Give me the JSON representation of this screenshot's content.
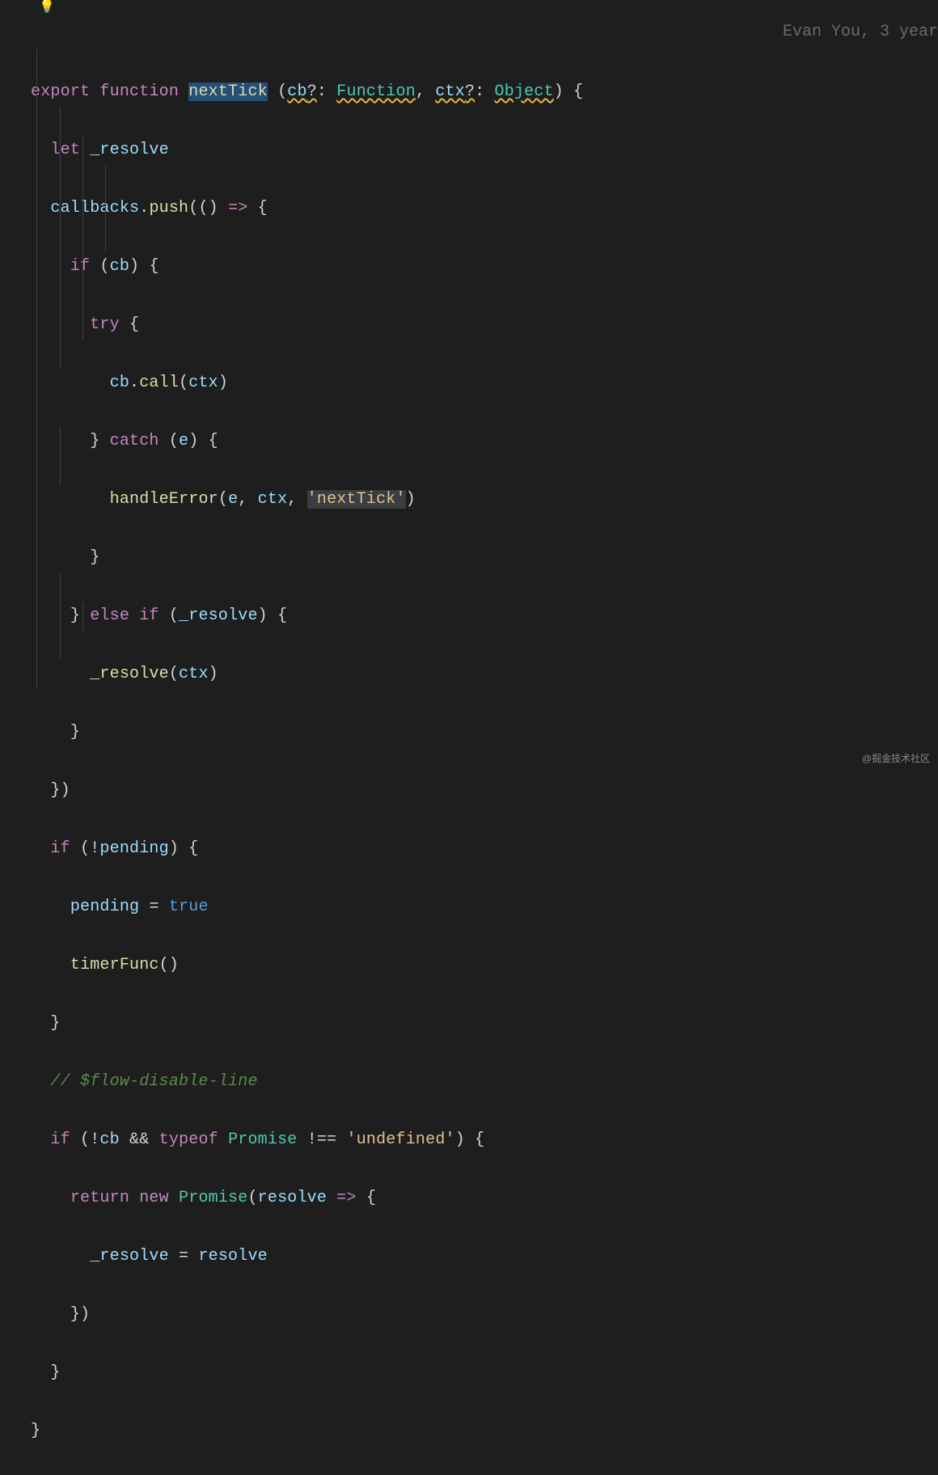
{
  "blame": "Evan You, 3 year",
  "bulb_icon": "💡",
  "watermark": "@掘金技术社区",
  "tokens": {
    "export": "export",
    "function": "function",
    "nextTick": "nextTick",
    "cb": "cb",
    "q": "?",
    "colon": ":",
    "Function": "Function",
    "comma": ",",
    "ctx": "ctx",
    "Object": "Object",
    "lbrace": "{",
    "rbrace": "}",
    "lparen": "(",
    "rparen": ")",
    "let": "let",
    "_resolve": "_resolve",
    "callbacks": "callbacks",
    "dot": ".",
    "push": "push",
    "arrow": "=>",
    "if": "if",
    "try": "try",
    "call": "call",
    "catch": "catch",
    "e": "e",
    "handleError": "handleError",
    "nextTickStr": "'nextTick'",
    "else": "else",
    "bang": "!",
    "pending": "pending",
    "eq": "=",
    "true": "true",
    "timerFunc": "timerFunc",
    "comment": "// $flow-disable-line",
    "amp": "&&",
    "typeof": "typeof",
    "Promise": "Promise",
    "neq": "!==",
    "undefinedStr": "'undefined'",
    "return": "return",
    "new": "new",
    "resolve": "resolve"
  }
}
